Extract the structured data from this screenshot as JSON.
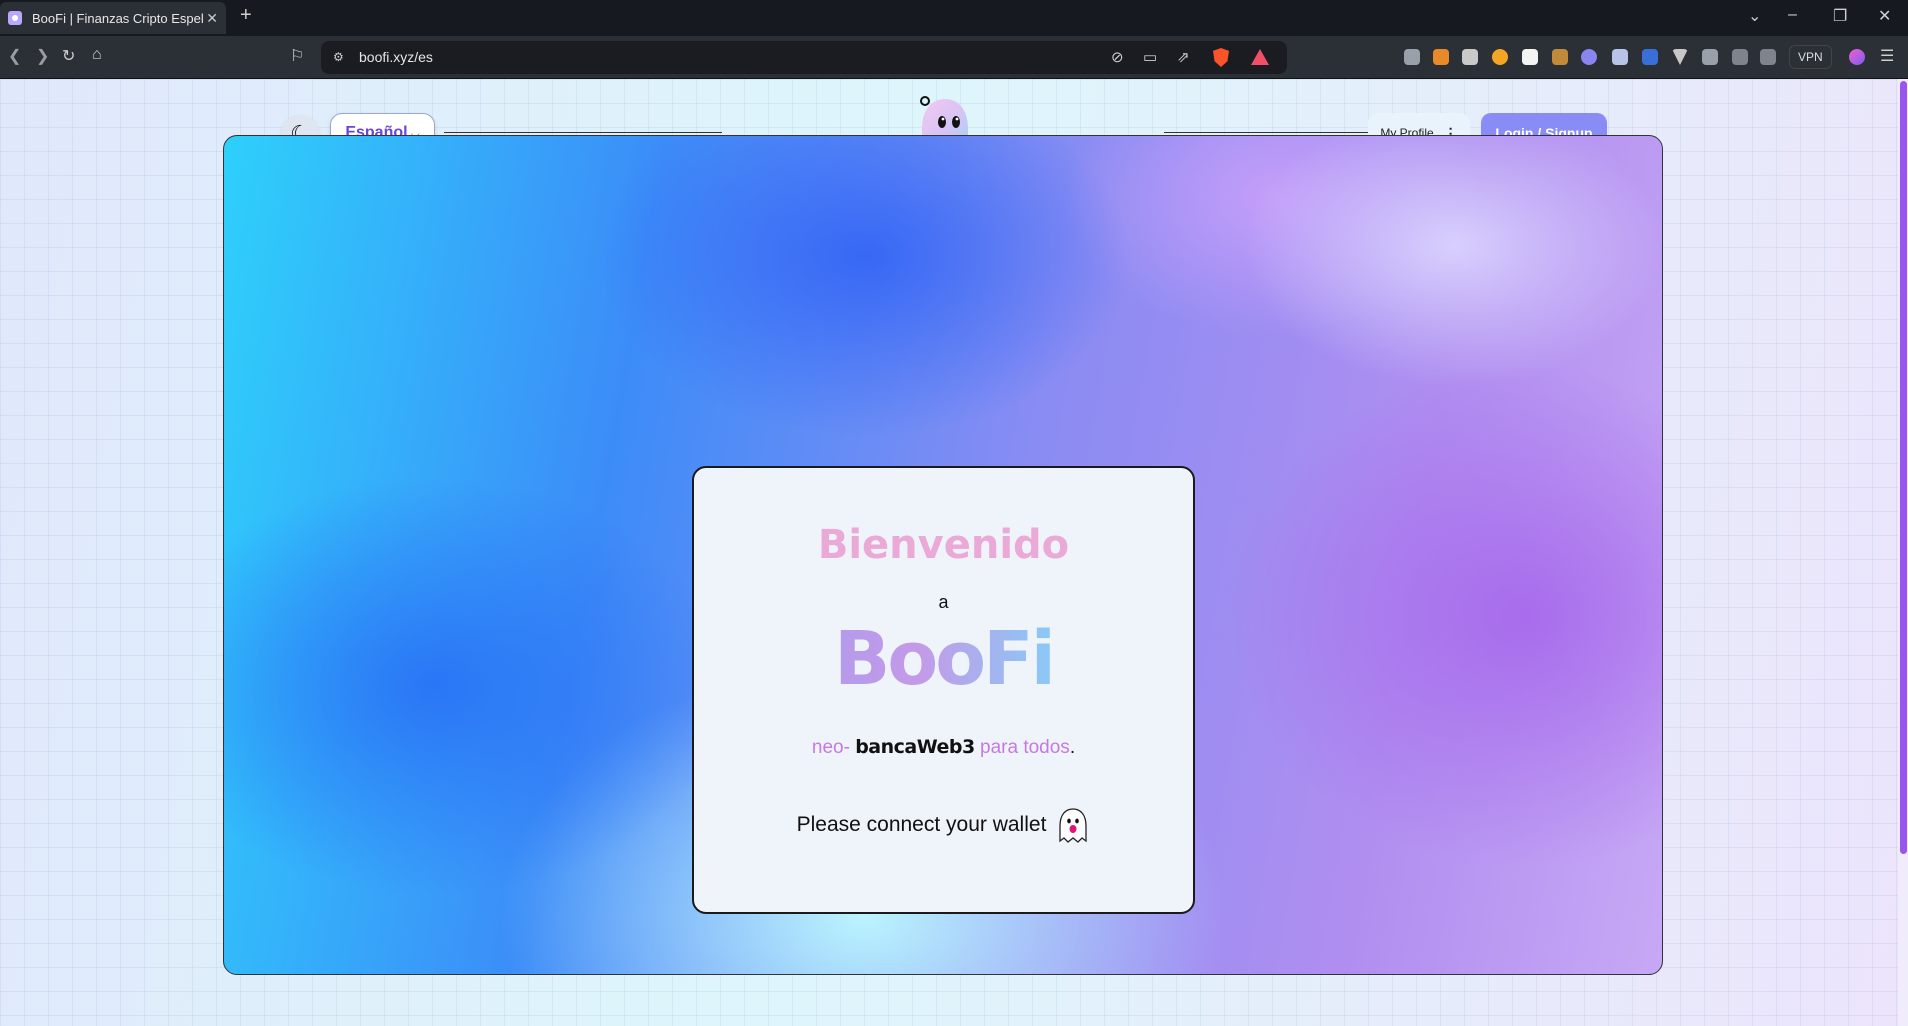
{
  "browser": {
    "tab_title": "BooFi | Finanzas Cripto Espeluznantes",
    "tab_close": "✕",
    "new_tab": "+",
    "url": "boofi.xyz/es",
    "vpn_label": "VPN",
    "window_controls": [
      "⌄",
      "–",
      "❐",
      "✕"
    ]
  },
  "header": {
    "language": "Español",
    "language_chevron": "⌵",
    "theme_icon": "☾",
    "profile_label": "My Profile",
    "profile_menu_icon": "⋮",
    "login_label": "Login / Signup"
  },
  "card": {
    "welcome": "Bienvenido",
    "a": "a",
    "brand": "BooFi",
    "tagline_neo": "neo-",
    "tagline_bank": "bancaWeb3",
    "tagline_para": "para todos",
    "tagline_dot": ".",
    "connect_prompt": "Please connect your wallet"
  },
  "colors": {
    "accent": "#8a8cf5",
    "language_text": "#6a45d8",
    "welcome": "#eaa9d6",
    "tagline_accent": "#c679e4"
  }
}
